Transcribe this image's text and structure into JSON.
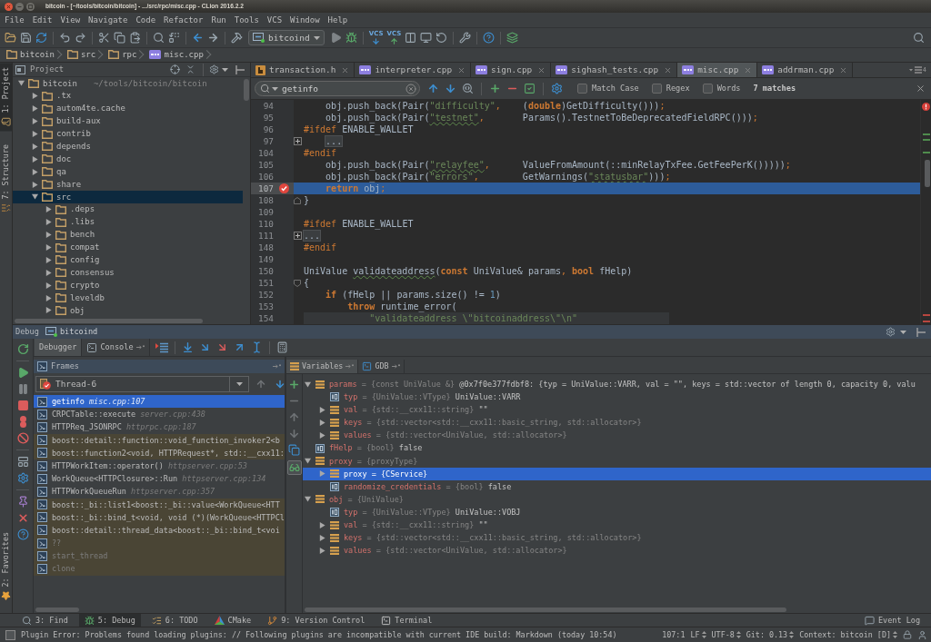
{
  "window": {
    "title": "bitcoin - [~/tools/bitcoin/bitcoin] - .../src/rpc/misc.cpp - CLion 2016.2.2"
  },
  "menu": [
    "File",
    "Edit",
    "View",
    "Navigate",
    "Code",
    "Refactor",
    "Run",
    "Tools",
    "VCS",
    "Window",
    "Help"
  ],
  "toolbar": {
    "run_config": "bitcoind",
    "vcs_labels": [
      "VCS",
      "VCS"
    ]
  },
  "breadcrumbs": [
    {
      "label": "bitcoin",
      "kind": "folder"
    },
    {
      "label": "src",
      "kind": "folder"
    },
    {
      "label": "rpc",
      "kind": "folder"
    },
    {
      "label": "misc.cpp",
      "kind": "cpp"
    }
  ],
  "tool_stripe": {
    "top": [
      {
        "label": "1: Project",
        "selected": true
      },
      {
        "label": "7: Structure",
        "selected": false
      }
    ],
    "bottom": [
      {
        "label": "2: Favorites",
        "selected": false
      }
    ]
  },
  "project": {
    "title": "Project",
    "tree": [
      {
        "name": "bitcoin",
        "path": "~/tools/bitcoin/bitcoin",
        "expanded": true,
        "selected": false,
        "children": [
          {
            "name": ".tx",
            "expanded": false,
            "selected": false
          },
          {
            "name": "autom4te.cache",
            "expanded": false,
            "selected": false
          },
          {
            "name": "build-aux",
            "expanded": false,
            "selected": false
          },
          {
            "name": "contrib",
            "expanded": false,
            "selected": false
          },
          {
            "name": "depends",
            "expanded": false,
            "selected": false
          },
          {
            "name": "doc",
            "expanded": false,
            "selected": false
          },
          {
            "name": "qa",
            "expanded": false,
            "selected": false
          },
          {
            "name": "share",
            "expanded": false,
            "selected": false
          },
          {
            "name": "src",
            "expanded": true,
            "selected": true,
            "children": [
              {
                "name": ".deps",
                "expanded": false,
                "selected": false
              },
              {
                "name": ".libs",
                "expanded": false,
                "selected": false
              },
              {
                "name": "bench",
                "expanded": false,
                "selected": false
              },
              {
                "name": "compat",
                "expanded": false,
                "selected": false
              },
              {
                "name": "config",
                "expanded": false,
                "selected": false
              },
              {
                "name": "consensus",
                "expanded": false,
                "selected": false
              },
              {
                "name": "crypto",
                "expanded": false,
                "selected": false
              },
              {
                "name": "leveldb",
                "expanded": false,
                "selected": false
              },
              {
                "name": "obj",
                "expanded": false,
                "selected": false
              }
            ]
          }
        ]
      }
    ]
  },
  "editor": {
    "tabs": [
      {
        "label": "transaction.h",
        "kind": "header",
        "selected": false
      },
      {
        "label": "interpreter.cpp",
        "kind": "cpp",
        "selected": false
      },
      {
        "label": "sign.cpp",
        "kind": "cpp",
        "selected": false
      },
      {
        "label": "sighash_tests.cpp",
        "kind": "cpp",
        "selected": false
      },
      {
        "label": "misc.cpp",
        "kind": "cpp",
        "selected": true
      },
      {
        "label": "addrman.cpp",
        "kind": "cpp",
        "selected": false
      }
    ],
    "hidden_tabs": "4",
    "search": {
      "query": "getinfo",
      "options": [
        {
          "label": "Match Case",
          "checked": false
        },
        {
          "label": "Regex",
          "checked": false
        },
        {
          "label": "Words",
          "checked": false
        }
      ],
      "matches": "7 matches"
    },
    "lines": [
      {
        "number": "94",
        "kind": "code",
        "tokens": [
          {
            "kind": "plain",
            "text": "    obj.push_back(Pair("
          },
          {
            "kind": "string",
            "text": "\"difficulty\""
          },
          {
            "kind": "punct",
            "text": ","
          },
          {
            "kind": "plain",
            "text": "    ("
          },
          {
            "kind": "keyword",
            "text": "double"
          },
          {
            "kind": "plain",
            "text": ")GetDifficulty()))"
          },
          {
            "kind": "punct",
            "text": ";"
          }
        ]
      },
      {
        "number": "95",
        "kind": "code",
        "tokens": [
          {
            "kind": "plain",
            "text": "    obj.push_back(Pair("
          },
          {
            "kind": "string_typo",
            "text": "\"testnet\""
          },
          {
            "kind": "punct",
            "text": ","
          },
          {
            "kind": "plain",
            "text": "       Params().TestnetToBeDeprecatedFieldRPC()))"
          },
          {
            "kind": "punct",
            "text": ";"
          }
        ]
      },
      {
        "number": "96",
        "kind": "code",
        "tokens": [
          {
            "kind": "directive",
            "text": "#ifdef"
          },
          {
            "kind": "plain",
            "text": " ENABLE_WALLET"
          }
        ]
      },
      {
        "number": "97",
        "kind": "folded",
        "tokens": [
          {
            "kind": "fold",
            "text": "    ..."
          }
        ]
      },
      {
        "number": "104",
        "kind": "code",
        "tokens": [
          {
            "kind": "directive",
            "text": "#endif"
          }
        ]
      },
      {
        "number": "105",
        "kind": "code",
        "tokens": [
          {
            "kind": "plain",
            "text": "    obj.push_back(Pair("
          },
          {
            "kind": "string_typo",
            "text": "\"relayfee\""
          },
          {
            "kind": "punct",
            "text": ","
          },
          {
            "kind": "plain",
            "text": "      ValueFromAmount(::minRelayTxFee.GetFeePerK()))))"
          },
          {
            "kind": "punct",
            "text": ";"
          }
        ]
      },
      {
        "number": "106",
        "kind": "code",
        "tokens": [
          {
            "kind": "plain",
            "text": "    obj.push_back(Pair("
          },
          {
            "kind": "string",
            "text": "\"errors\""
          },
          {
            "kind": "punct",
            "text": ","
          },
          {
            "kind": "plain",
            "text": "        GetWarnings("
          },
          {
            "kind": "string_typo",
            "text": "\"statusbar\""
          },
          {
            "kind": "plain",
            "text": ")))"
          },
          {
            "kind": "punct",
            "text": ";"
          }
        ]
      },
      {
        "number": "107",
        "kind": "execution",
        "tokens": [
          {
            "kind": "keyword",
            "text": "    return"
          },
          {
            "kind": "plain",
            "text": " obj"
          },
          {
            "kind": "punct",
            "text": ";"
          }
        ]
      },
      {
        "number": "108",
        "kind": "fold_end",
        "tokens": [
          {
            "kind": "plain",
            "text": "}"
          }
        ]
      },
      {
        "number": "109",
        "kind": "code"
      },
      {
        "number": "110",
        "kind": "code",
        "tokens": [
          {
            "kind": "directive",
            "text": "#ifdef"
          },
          {
            "kind": "plain",
            "text": " ENABLE_WALLET"
          }
        ]
      },
      {
        "number": "111",
        "kind": "folded",
        "tokens": [
          {
            "kind": "fold",
            "text": "..."
          }
        ]
      },
      {
        "number": "148",
        "kind": "code",
        "tokens": [
          {
            "kind": "directive",
            "text": "#endif"
          }
        ]
      },
      {
        "number": "149",
        "kind": "code"
      },
      {
        "number": "150",
        "kind": "code",
        "tokens": [
          {
            "kind": "plain",
            "text": "UniValue "
          },
          {
            "kind": "name_typo",
            "text": "validateaddress"
          },
          {
            "kind": "plain",
            "text": "("
          },
          {
            "kind": "keyword",
            "text": "const"
          },
          {
            "kind": "plain",
            "text": " UniValue& params"
          },
          {
            "kind": "punct",
            "text": ","
          },
          {
            "kind": "keyword",
            "text": " bool"
          },
          {
            "kind": "plain",
            "text": " fHelp)"
          }
        ]
      },
      {
        "number": "151",
        "kind": "fold_start",
        "tokens": [
          {
            "kind": "plain",
            "text": "{"
          }
        ]
      },
      {
        "number": "152",
        "kind": "code",
        "tokens": [
          {
            "kind": "keyword",
            "text": "    if"
          },
          {
            "kind": "plain",
            "text": " (fHelp || params.size() != "
          },
          {
            "kind": "number",
            "text": "1"
          },
          {
            "kind": "plain",
            "text": ")"
          }
        ]
      },
      {
        "number": "153",
        "kind": "code",
        "tokens": [
          {
            "kind": "keyword",
            "text": "        throw"
          },
          {
            "kind": "plain",
            "text": " runtime_error("
          }
        ]
      },
      {
        "number": "154",
        "kind": "shaded",
        "tokens": [
          {
            "kind": "string",
            "text": "            \"validateaddress \\\"bitcoinaddress\\\"\\n\""
          }
        ]
      }
    ]
  },
  "debug": {
    "title": "Debug",
    "session": "bitcoind",
    "tabs": [
      {
        "label": "Debugger",
        "selected": true
      },
      {
        "label": "Console",
        "selected": false
      }
    ],
    "frames": {
      "title": "Frames",
      "thread": "Thread-6",
      "items": [
        {
          "function": "getinfo",
          "location": "misc.cpp:107",
          "kind": "project",
          "selected": true
        },
        {
          "function": "CRPCTable::execute",
          "location": "server.cpp:438",
          "kind": "project",
          "selected": false
        },
        {
          "function": "HTTPReq_JSONRPC",
          "location": "httprpc.cpp:187",
          "kind": "project",
          "selected": false
        },
        {
          "function": "boost::detail::function::void_function_invoker2<b",
          "kind": "library",
          "selected": false
        },
        {
          "function": "boost::function2<void, HTTPRequest*, std::__cxx11:",
          "kind": "library",
          "selected": false
        },
        {
          "function": "HTTPWorkItem::operator()",
          "location": "httpserver.cpp:53",
          "kind": "project",
          "selected": false
        },
        {
          "function": "WorkQueue<HTTPClosure>::Run",
          "location": "httpserver.cpp:134",
          "kind": "project",
          "selected": false
        },
        {
          "function": "HTTPWorkQueueRun",
          "location": "httpserver.cpp:357",
          "kind": "project",
          "selected": false
        },
        {
          "function": "boost::_bi::list1<boost::_bi::value<WorkQueue<HTT",
          "kind": "library",
          "selected": false
        },
        {
          "function": "boost::_bi::bind_t<void, void (*)(WorkQueue<HTTPCl",
          "kind": "library",
          "selected": false
        },
        {
          "function": "boost::detail::thread_data<boost::_bi::bind_t<voi",
          "kind": "library",
          "selected": false
        },
        {
          "function": "??",
          "kind": "unknown",
          "selected": false
        },
        {
          "function": "start_thread",
          "kind": "unknown",
          "selected": false
        },
        {
          "function": "clone",
          "kind": "unknown",
          "selected": false
        }
      ]
    },
    "variables": {
      "tabs": [
        {
          "label": "Variables",
          "selected": true
        },
        {
          "label": "GDB",
          "selected": false
        }
      ],
      "items": [
        {
          "name": "params",
          "type": "= {const UniValue &}",
          "value": "@0x7f0e377fdbf8: {typ = UniValue::VARR, val = \"\", keys = std::vector of length 0, capacity 0, valu",
          "kind": "object",
          "expanded": true,
          "selected": false,
          "children": [
            {
              "name": "typ",
              "type": "= {UniValue::VType}",
              "value": "UniValue::VARR",
              "kind": "primitive",
              "selected": false
            },
            {
              "name": "val",
              "type": "= {std::__cxx11::string}",
              "value": "\"\"",
              "kind": "object",
              "expanded": false,
              "selected": false
            },
            {
              "name": "keys",
              "type": "= {std::vector<std::__cxx11::basic_string, std::allocator>}",
              "kind": "object",
              "expanded": false,
              "selected": false
            },
            {
              "name": "values",
              "type": "= {std::vector<UniValue, std::allocator>}",
              "kind": "object",
              "expanded": false,
              "selected": false
            }
          ]
        },
        {
          "name": "fHelp",
          "type": "= {bool}",
          "value": "false",
          "kind": "primitive",
          "selected": false
        },
        {
          "name": "proxy",
          "type": "= {proxyType}",
          "kind": "object",
          "expanded": true,
          "selected": false,
          "children": [
            {
              "name": "proxy",
              "type": "= {CService}",
              "kind": "object",
              "expanded": false,
              "selected": true
            },
            {
              "name": "randomize_credentials",
              "type": "= {bool}",
              "value": "false",
              "kind": "primitive",
              "selected": false
            }
          ]
        },
        {
          "name": "obj",
          "type": "= {UniValue}",
          "kind": "object",
          "expanded": true,
          "selected": false,
          "children": [
            {
              "name": "typ",
              "type": "= {UniValue::VType}",
              "value": "UniValue::VOBJ",
              "kind": "primitive",
              "selected": false
            },
            {
              "name": "val",
              "type": "= {std::__cxx11::string}",
              "value": "\"\"",
              "kind": "object",
              "expanded": false,
              "selected": false
            },
            {
              "name": "keys",
              "type": "= {std::vector<std::__cxx11::basic_string, std::allocator>}",
              "kind": "object",
              "expanded": false,
              "selected": false
            },
            {
              "name": "values",
              "type": "= {std::vector<UniValue, std::allocator>}",
              "kind": "object",
              "expanded": false,
              "selected": false
            }
          ]
        }
      ]
    }
  },
  "tool_windows": {
    "left": [
      {
        "label": "3: Find",
        "selected": false
      },
      {
        "label": "5: Debug",
        "selected": true
      },
      {
        "label": "6: TODO",
        "selected": false
      },
      {
        "label": "CMake",
        "selected": false
      },
      {
        "label": "9: Version Control",
        "selected": false
      },
      {
        "label": "Terminal",
        "selected": false
      }
    ],
    "right": [
      {
        "label": "Event Log",
        "selected": false
      }
    ]
  },
  "status_bar": {
    "message": "Plugin Error: Problems found loading plugins: // Following plugins are incompatible with current IDE build: Markdown (today 10:54)",
    "position": "107:1",
    "widgets": [
      "LF",
      "UTF-8",
      "Git: 0.13",
      "Context: bitcoin [D]"
    ]
  }
}
